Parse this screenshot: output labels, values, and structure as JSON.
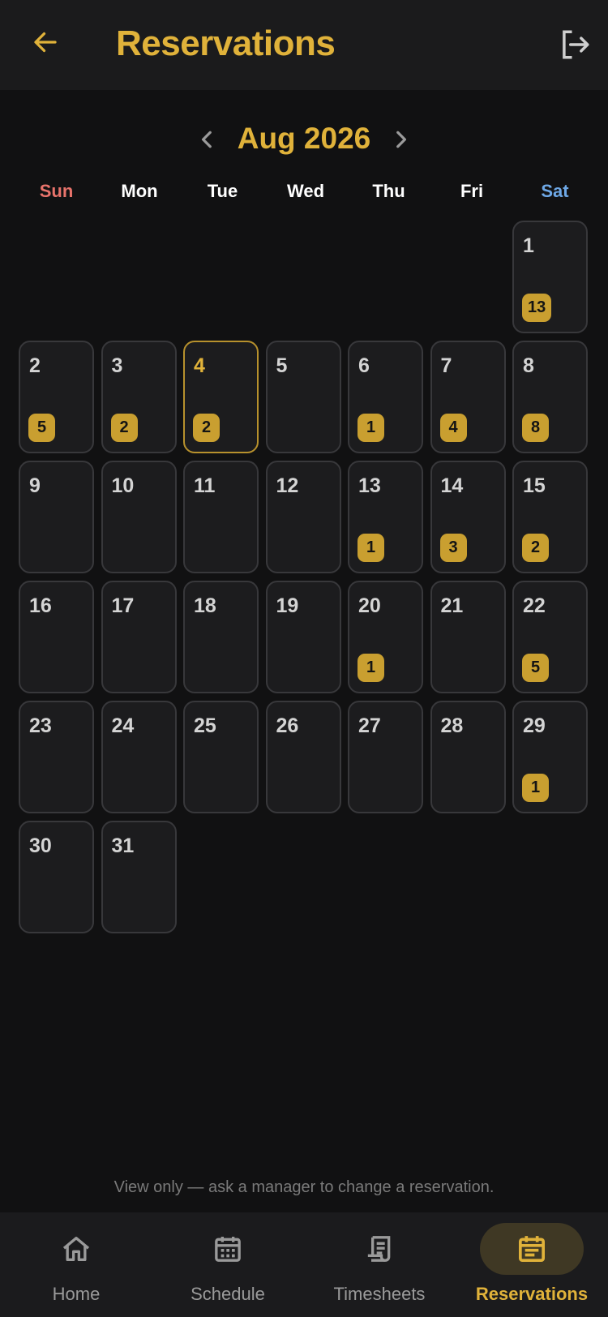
{
  "app_bar": {
    "title": "Reservations",
    "back_icon": "arrow-left-icon",
    "logout_icon": "logout-icon"
  },
  "colors": {
    "accent": "#e0b23a",
    "badge": "#c99f30",
    "sunday": "#e8736b",
    "saturday": "#6ea8e6",
    "muted": "#7a7a7a"
  },
  "calendar": {
    "month_label": "Aug 2026",
    "weekdays": [
      "Sun",
      "Mon",
      "Tue",
      "Wed",
      "Thu",
      "Fri",
      "Sat"
    ],
    "leading_blanks": 6,
    "today": "4",
    "days": [
      {
        "day": "1",
        "count": "13"
      },
      {
        "day": "2",
        "count": "5"
      },
      {
        "day": "3",
        "count": "2"
      },
      {
        "day": "4",
        "count": "2"
      },
      {
        "day": "5",
        "count": ""
      },
      {
        "day": "6",
        "count": "1"
      },
      {
        "day": "7",
        "count": "4"
      },
      {
        "day": "8",
        "count": "8"
      },
      {
        "day": "9",
        "count": ""
      },
      {
        "day": "10",
        "count": ""
      },
      {
        "day": "11",
        "count": ""
      },
      {
        "day": "12",
        "count": ""
      },
      {
        "day": "13",
        "count": "1"
      },
      {
        "day": "14",
        "count": "3"
      },
      {
        "day": "15",
        "count": "2"
      },
      {
        "day": "16",
        "count": ""
      },
      {
        "day": "17",
        "count": ""
      },
      {
        "day": "18",
        "count": ""
      },
      {
        "day": "19",
        "count": ""
      },
      {
        "day": "20",
        "count": "1"
      },
      {
        "day": "21",
        "count": ""
      },
      {
        "day": "22",
        "count": "5"
      },
      {
        "day": "23",
        "count": ""
      },
      {
        "day": "24",
        "count": ""
      },
      {
        "day": "25",
        "count": ""
      },
      {
        "day": "26",
        "count": ""
      },
      {
        "day": "27",
        "count": ""
      },
      {
        "day": "28",
        "count": ""
      },
      {
        "day": "29",
        "count": "1"
      },
      {
        "day": "30",
        "count": ""
      },
      {
        "day": "31",
        "count": ""
      }
    ]
  },
  "footer_note": "View only — ask a manager to change a reservation.",
  "bottom_nav": {
    "items": [
      {
        "label": "Home",
        "icon": "home-icon",
        "active": false
      },
      {
        "label": "Schedule",
        "icon": "calendar-grid-icon",
        "active": false
      },
      {
        "label": "Timesheets",
        "icon": "receipt-icon",
        "active": false
      },
      {
        "label": "Reservations",
        "icon": "event-note-icon",
        "active": true
      }
    ]
  }
}
